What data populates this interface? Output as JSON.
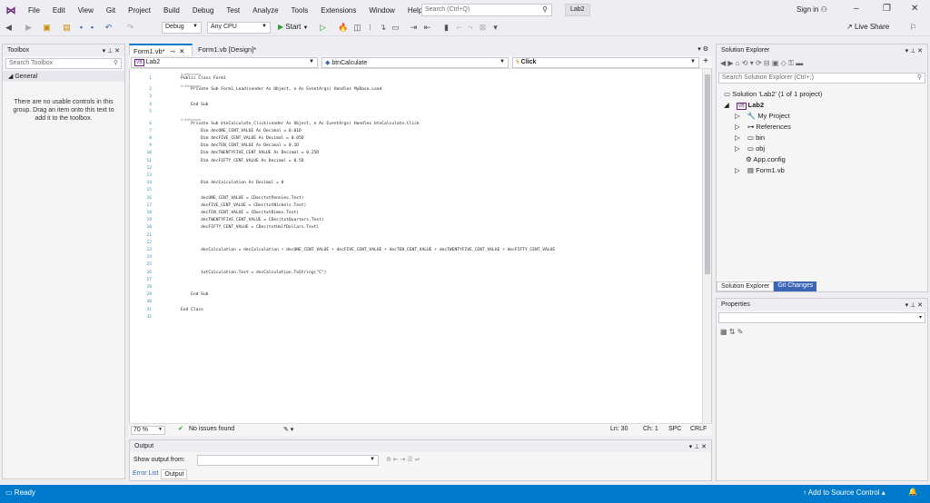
{
  "menu": {
    "items": [
      "File",
      "Edit",
      "View",
      "Git",
      "Project",
      "Build",
      "Debug",
      "Test",
      "Analyze",
      "Tools",
      "Extensions",
      "Window",
      "Help"
    ],
    "search_placeholder": "Search (Ctrl+Q)",
    "project_name": "Lab2",
    "signin": "Sign in",
    "live_share": "Live Share"
  },
  "toolbar": {
    "config": "Debug",
    "platform": "Any CPU",
    "start_label": "Start"
  },
  "toolbox": {
    "title": "Toolbox",
    "search_placeholder": "Search Toolbox",
    "group": "General",
    "empty_message": "There are no usable controls in this group. Drag an item onto this text to add it to the toolbox."
  },
  "editor": {
    "tabs": [
      "Form1.vb*",
      "Form1.vb [Design]*"
    ],
    "nav_project": "Lab2",
    "nav_object": "btnCalculate",
    "nav_event": "Click",
    "zoom": "70 %",
    "issues": "No issues found",
    "ln": "Ln: 30",
    "ch": "Ch: 1",
    "spc": "SPC",
    "crlf": "CRLF",
    "lines": [
      {
        "n": "1",
        "text": "Public Class Form1",
        "ref": "2 references"
      },
      {
        "n": "2",
        "text": "    Private Sub Form1_Load(sender As Object, e As EventArgs) Handles MyBase.Load",
        "ref": "0 references"
      },
      {
        "n": "3",
        "text": ""
      },
      {
        "n": "4",
        "text": "    End Sub"
      },
      {
        "n": "5",
        "text": ""
      },
      {
        "n": "6",
        "text": "    Private Sub btnCalculate_Click(sender As Object, e As EventArgs) Handles btnCalculate.Click",
        "ref": "0 references"
      },
      {
        "n": "7",
        "text": "        Dim decONE_CENT_VALUE As Decimal = 0.01D"
      },
      {
        "n": "8",
        "text": "        Dim decFIVE_CENT_VALUE As Decimal = 0.05D"
      },
      {
        "n": "9",
        "text": "        Dim decTEN_CENT_VALUE As Decimal = 0.1D"
      },
      {
        "n": "10",
        "text": "        Dim decTWENTYFIVE_CENT_VALUE As Decimal = 0.25D"
      },
      {
        "n": "11",
        "text": "        Dim decFIFTY_CENT_VALUE As Decimal = 0.5D"
      },
      {
        "n": "12",
        "text": ""
      },
      {
        "n": "13",
        "text": ""
      },
      {
        "n": "14",
        "text": "        Dim decCalculation As Decimal = 0"
      },
      {
        "n": "15",
        "text": ""
      },
      {
        "n": "16",
        "text": "        decONE_CENT_VALUE = CDec(txtPennies.Text)"
      },
      {
        "n": "17",
        "text": "        decFIVE_CENT_VALUE = CDec(txtNickels.Text)"
      },
      {
        "n": "18",
        "text": "        decTEN_CENT_VALUE = CDec(txtDimes.Text)"
      },
      {
        "n": "19",
        "text": "        decTWENTYFIVE_CENT_VALUE = CDec(txtQuarters.Text)"
      },
      {
        "n": "20",
        "text": "        decFIFTY_CENT_VALUE = CDec(txtHalfDollars.Text)"
      },
      {
        "n": "21",
        "text": ""
      },
      {
        "n": "22",
        "text": ""
      },
      {
        "n": "23",
        "text": "        decCalculation = decCalculation + decONE_CENT_VALUE + decFIVE_CENT_VALUE + decTEN_CENT_VALUE + decTWENTYFIVE_CENT_VALUE + decFIFTY_CENT_VALUE"
      },
      {
        "n": "24",
        "text": ""
      },
      {
        "n": "25",
        "text": ""
      },
      {
        "n": "26",
        "text": "        txtCalculation.Text = decCalculation.ToString(\"C\")"
      },
      {
        "n": "27",
        "text": ""
      },
      {
        "n": "28",
        "text": ""
      },
      {
        "n": "29",
        "text": "    End Sub"
      },
      {
        "n": "30",
        "text": ""
      },
      {
        "n": "31",
        "text": "End Class"
      },
      {
        "n": "32",
        "text": ""
      }
    ]
  },
  "output": {
    "title": "Output",
    "show_from": "Show output from:",
    "tabs": [
      "Error List",
      "Output"
    ]
  },
  "solution_explorer": {
    "title": "Solution Explorer",
    "search_placeholder": "Search Solution Explorer (Ctrl+;)",
    "solution": "Solution 'Lab2' (1 of 1 project)",
    "project": "Lab2",
    "items": [
      "My Project",
      "References",
      "bin",
      "obj",
      "App.config",
      "Form1.vb"
    ],
    "tabs": [
      "Solution Explorer",
      "Git Changes"
    ]
  },
  "properties": {
    "title": "Properties"
  },
  "statusbar": {
    "ready": "Ready",
    "source_control": "Add to Source Control"
  },
  "colors": {
    "accent": "#007acc",
    "chrome": "#eeeef2"
  }
}
